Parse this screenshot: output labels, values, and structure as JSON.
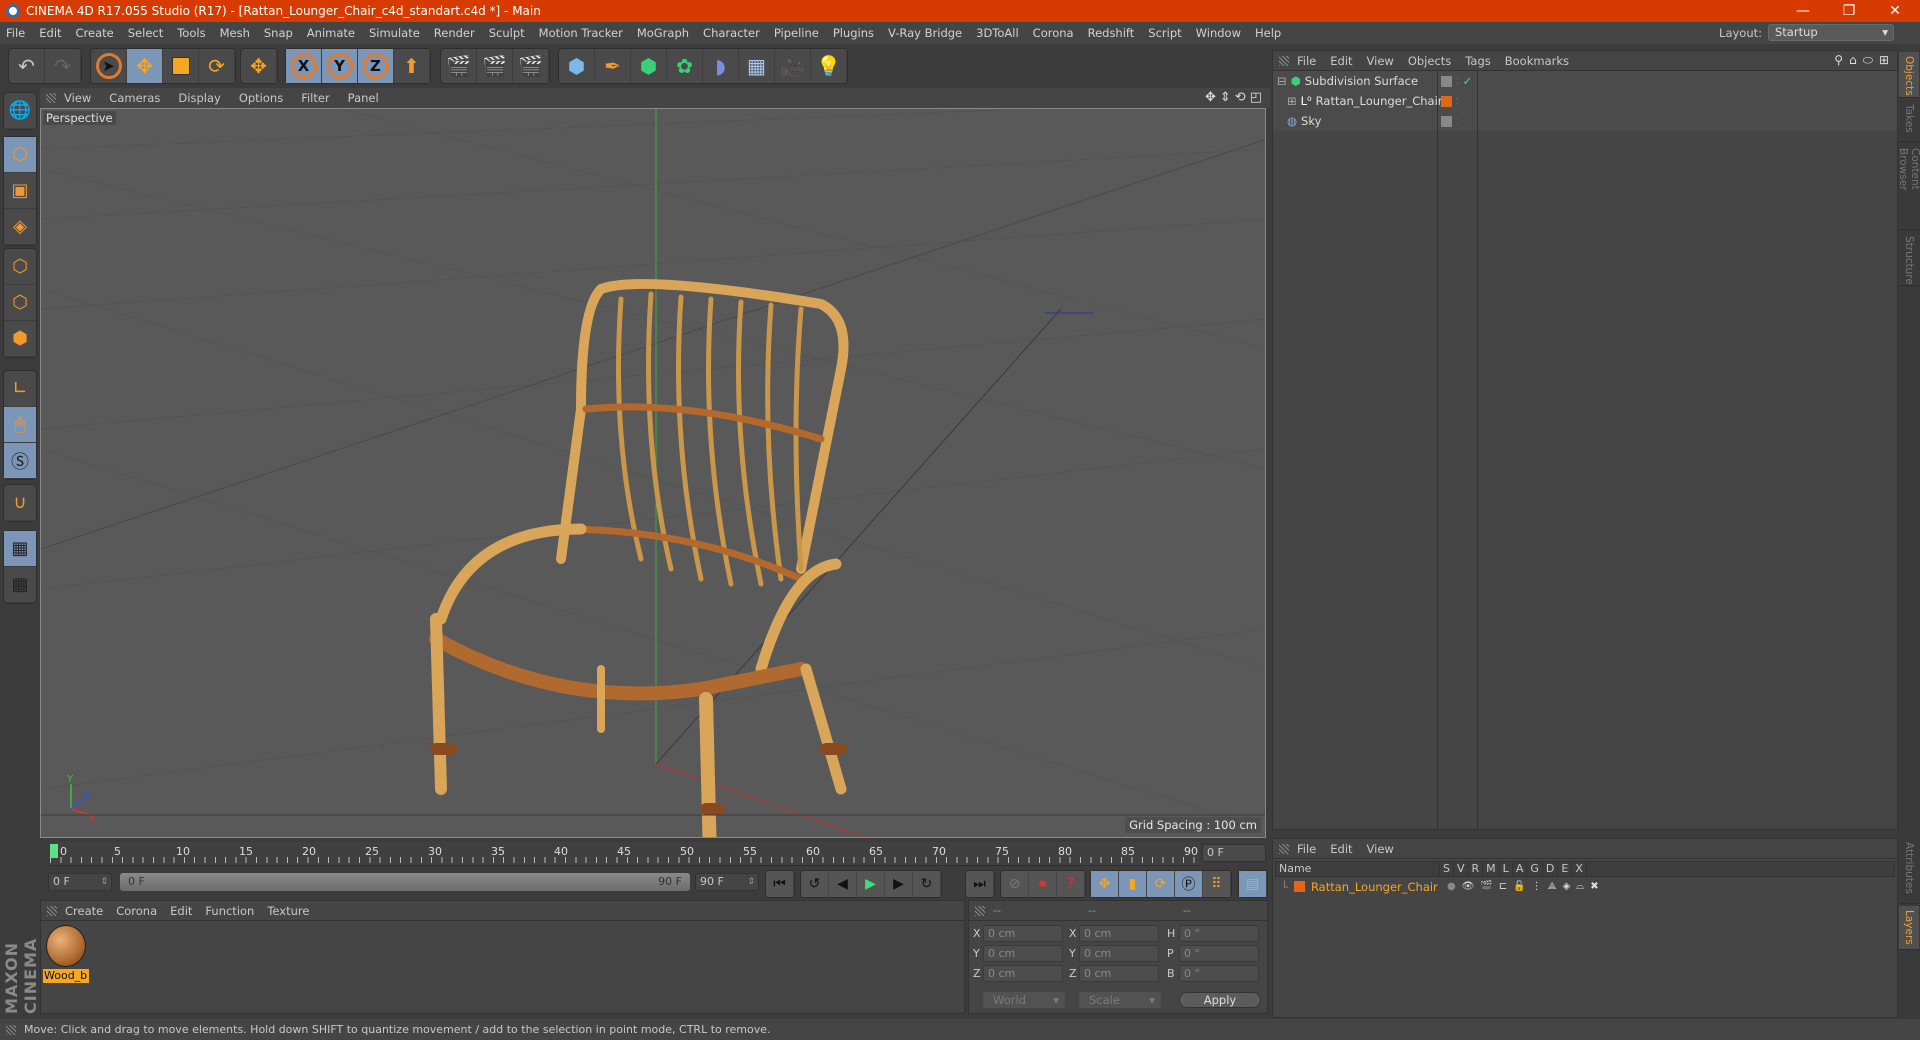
{
  "window": {
    "title": "CINEMA 4D R17.055 Studio (R17) - [Rattan_Lounger_Chair_c4d_standart.c4d *] - Main",
    "controls": {
      "minimize": "—",
      "restore": "❐",
      "close": "✕"
    }
  },
  "menubar": [
    "File",
    "Edit",
    "Create",
    "Select",
    "Tools",
    "Mesh",
    "Snap",
    "Animate",
    "Simulate",
    "Render",
    "Sculpt",
    "Motion Tracker",
    "MoGraph",
    "Character",
    "Pipeline",
    "Plugins",
    "V-Ray Bridge",
    "3DToAll",
    "Corona",
    "Redshift",
    "Script",
    "Window",
    "Help"
  ],
  "layout": {
    "label": "Layout:",
    "value": "Startup"
  },
  "toolbar": {
    "groups": [
      [
        "undo-icon",
        "redo-icon"
      ],
      [
        "live-selection-icon",
        "move-icon",
        "scale-icon",
        "rotate-icon"
      ],
      [
        "last-tool-icon"
      ],
      [
        "x-axis-icon",
        "y-axis-icon",
        "z-axis-icon",
        "coordinate-system-icon"
      ],
      [
        "render-view-icon",
        "render-picture-viewer-icon",
        "render-settings-icon"
      ],
      [
        "cube-icon",
        "pen-icon",
        "subdivision-icon",
        "mograph-cloner-icon",
        "deformer-icon",
        "floor-icon",
        "camera-icon",
        "light-icon"
      ]
    ],
    "axis_labels": [
      "X",
      "Y",
      "Z"
    ]
  },
  "left_tools": [
    "make-editable-icon",
    "model-mode-icon",
    "texture-mode-icon",
    "workplane-mode-icon",
    "points-mode-icon",
    "edges-mode-icon",
    "polygons-mode-icon",
    "axis-mode-icon",
    "tweak-mode-icon",
    "solo-mode-icon",
    "snap-icon",
    "locked-workplane-icon",
    "planar-workplane-icon"
  ],
  "viewport": {
    "menu": [
      "View",
      "Cameras",
      "Display",
      "Options",
      "Filter",
      "Panel"
    ],
    "label": "Perspective",
    "grid_spacing": "Grid Spacing : 100 cm",
    "axis": {
      "x": "X",
      "y": "Y",
      "z": "Z"
    }
  },
  "timeline": {
    "ticks": [
      "0",
      "5",
      "10",
      "15",
      "20",
      "25",
      "30",
      "35",
      "40",
      "45",
      "50",
      "55",
      "60",
      "65",
      "70",
      "75",
      "80",
      "85",
      "90"
    ],
    "current_frame": "0 F",
    "start_field": "0 F",
    "range_start": "0 F",
    "range_end": "90 F",
    "end_field": "90 F"
  },
  "material_manager": {
    "menu": [
      "Create",
      "Corona",
      "Edit",
      "Function",
      "Texture"
    ],
    "materials": [
      {
        "name": "Wood_b"
      }
    ]
  },
  "branding": "MAXON CINEMA 4D",
  "coordinates": {
    "headers": [
      "--",
      "--",
      "--"
    ],
    "rows": [
      {
        "l1": "X",
        "v1": "0 cm",
        "l2": "X",
        "v2": "0 cm",
        "l3": "H",
        "v3": "0 °"
      },
      {
        "l1": "Y",
        "v1": "0 cm",
        "l2": "Y",
        "v2": "0 cm",
        "l3": "P",
        "v3": "0 °"
      },
      {
        "l1": "Z",
        "v1": "0 cm",
        "l2": "Z",
        "v2": "0 cm",
        "l3": "B",
        "v3": "0 °"
      }
    ],
    "mode_dropdown": "World",
    "transform_dropdown": "Scale",
    "apply_label": "Apply"
  },
  "object_manager": {
    "menu": [
      "File",
      "Edit",
      "View",
      "Objects",
      "Tags",
      "Bookmarks"
    ],
    "objects": [
      {
        "name": "Subdivision Surface",
        "icon": "subdivision-surface-icon"
      },
      {
        "name": "Rattan_Lounger_Chair",
        "icon": "null-object-icon"
      },
      {
        "name": "Sky",
        "icon": "sky-icon"
      }
    ]
  },
  "layer_manager": {
    "menu": [
      "File",
      "Edit",
      "View"
    ],
    "columns": [
      "Name",
      "S",
      "V",
      "R",
      "M",
      "L",
      "A",
      "G",
      "D",
      "E",
      "X"
    ],
    "layers": [
      {
        "name": "Rattan_Lounger_Chair",
        "color": "#e0661a"
      }
    ]
  },
  "side_tabs": {
    "top": [
      "Objects",
      "Takes",
      "Content Browser",
      "Structure"
    ],
    "bottom": [
      "Attributes",
      "Layers"
    ]
  },
  "status": "Move: Click and drag to move elements. Hold down SHIFT to quantize movement / add to the selection in point mode, CTRL to remove.",
  "colors": {
    "title_bar": "#d83b01",
    "accent_orange": "#f29a2e",
    "active_blue": "#7c96b8",
    "layer_color": "#e0661a",
    "timeline_cursor": "#5ee08a"
  }
}
